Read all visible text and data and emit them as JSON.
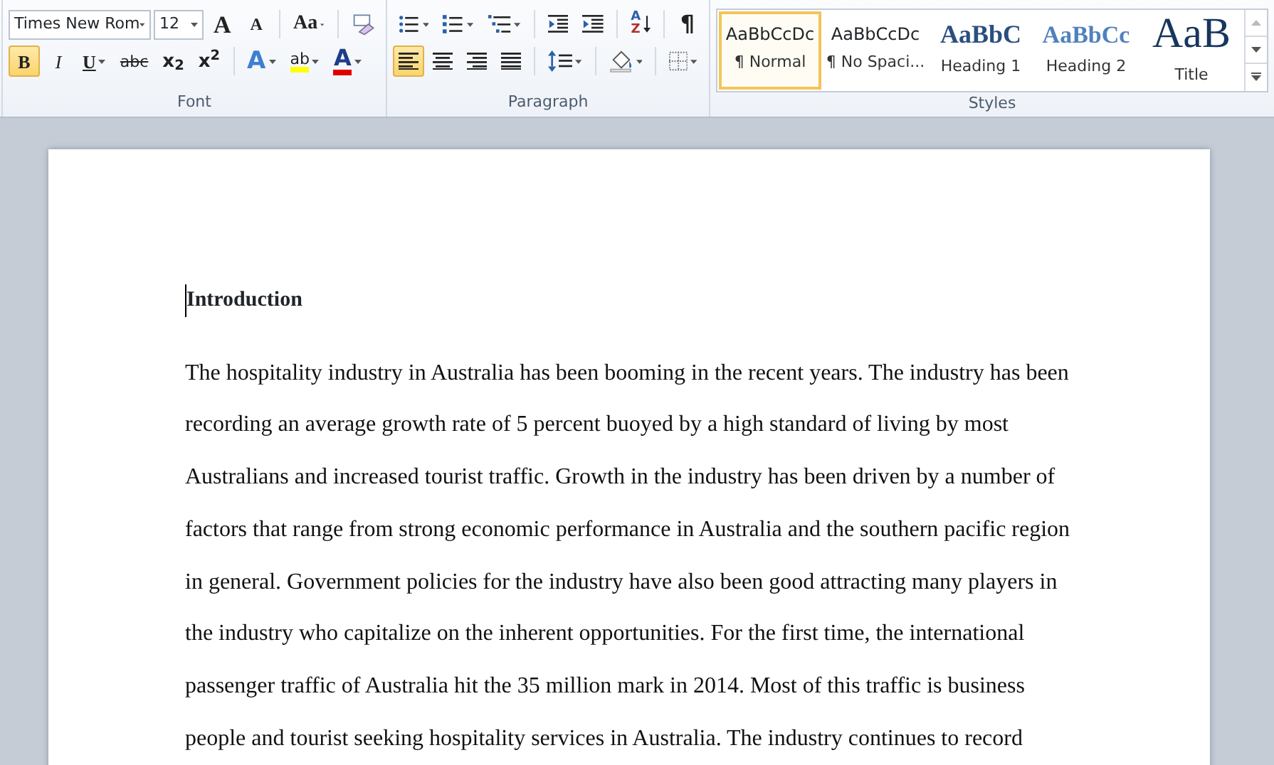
{
  "ribbon": {
    "font": {
      "label": "Font",
      "font_name": "Times New Rom",
      "font_size": "12",
      "top_buttons": [
        {
          "kind": "grow",
          "glyph": "A"
        },
        {
          "kind": "shrink",
          "glyph": "A"
        },
        {
          "kind": "case",
          "glyph": "Aa"
        },
        {
          "kind": "clear"
        }
      ],
      "format_buttons": [
        {
          "kind": "bold",
          "glyph": "B",
          "selected": true
        },
        {
          "kind": "italic",
          "glyph": "I",
          "selected": false
        },
        {
          "kind": "underline",
          "glyph": "U",
          "selected": false
        },
        {
          "kind": "strike",
          "glyph": "abc",
          "selected": false
        },
        {
          "kind": "subscript",
          "glyph": "x$_{2}$",
          "selected": false
        },
        {
          "kind": "superscript",
          "glyph": "x$^{2}$",
          "selected": false
        }
      ],
      "color_buttons": [
        {
          "kind": "effects",
          "glyph": "A"
        },
        {
          "kind": "highlight",
          "glyph": "ab",
          "color": "#ffff00"
        },
        {
          "kind": "fontcolor",
          "glyph": "A",
          "color": "#e00000"
        }
      ]
    },
    "paragraph": {
      "label": "Paragraph",
      "top_buttons": [
        {
          "kind": "bullets"
        },
        {
          "kind": "numbering"
        },
        {
          "kind": "multilevel"
        },
        {
          "kind": "outdent"
        },
        {
          "kind": "indent"
        },
        {
          "kind": "sort",
          "glyph": "A",
          "glyph2": "Z"
        },
        {
          "kind": "marks",
          "glyph": "¶"
        }
      ],
      "align_buttons": [
        {
          "kind": "left",
          "selected": true
        },
        {
          "kind": "center",
          "selected": false
        },
        {
          "kind": "right",
          "selected": false
        },
        {
          "kind": "justify",
          "selected": false
        }
      ],
      "other_buttons": [
        {
          "kind": "spacing"
        },
        {
          "kind": "shading"
        },
        {
          "kind": "borders"
        }
      ]
    },
    "styles": {
      "label": "Styles",
      "items": [
        {
          "kind": "normal",
          "preview": "AaBbCcDc",
          "label": "¶ Normal",
          "selected": true
        },
        {
          "kind": "nospacing",
          "preview": "AaBbCcDc",
          "label": "¶ No Spaci...",
          "selected": false
        },
        {
          "kind": "heading1",
          "preview": "AaBbC",
          "label": "Heading 1",
          "selected": false
        },
        {
          "kind": "heading2",
          "preview": "AaBbCc",
          "label": "Heading 2",
          "selected": false
        },
        {
          "kind": "title",
          "preview": "AaB",
          "label": "Title",
          "selected": false
        }
      ]
    }
  },
  "document": {
    "heading": "Introduction",
    "paragraph": "The hospitality industry in Australia has been booming in the recent years. The industry has been recording an average growth rate of 5 percent buoyed by a high standard of living by most Australians and increased tourist traffic. Growth in the industry has been driven by a number of factors that range from strong economic performance in Australia and the southern pacific region in general.  Government policies for the industry have also been good attracting many players in the industry who capitalize on the inherent opportunities. For the first time, the international passenger traffic of Australia hit the 35 million mark in 2014. Most of this traffic is business people and tourist seeking hospitality services in Australia. The industry continues to record"
  }
}
